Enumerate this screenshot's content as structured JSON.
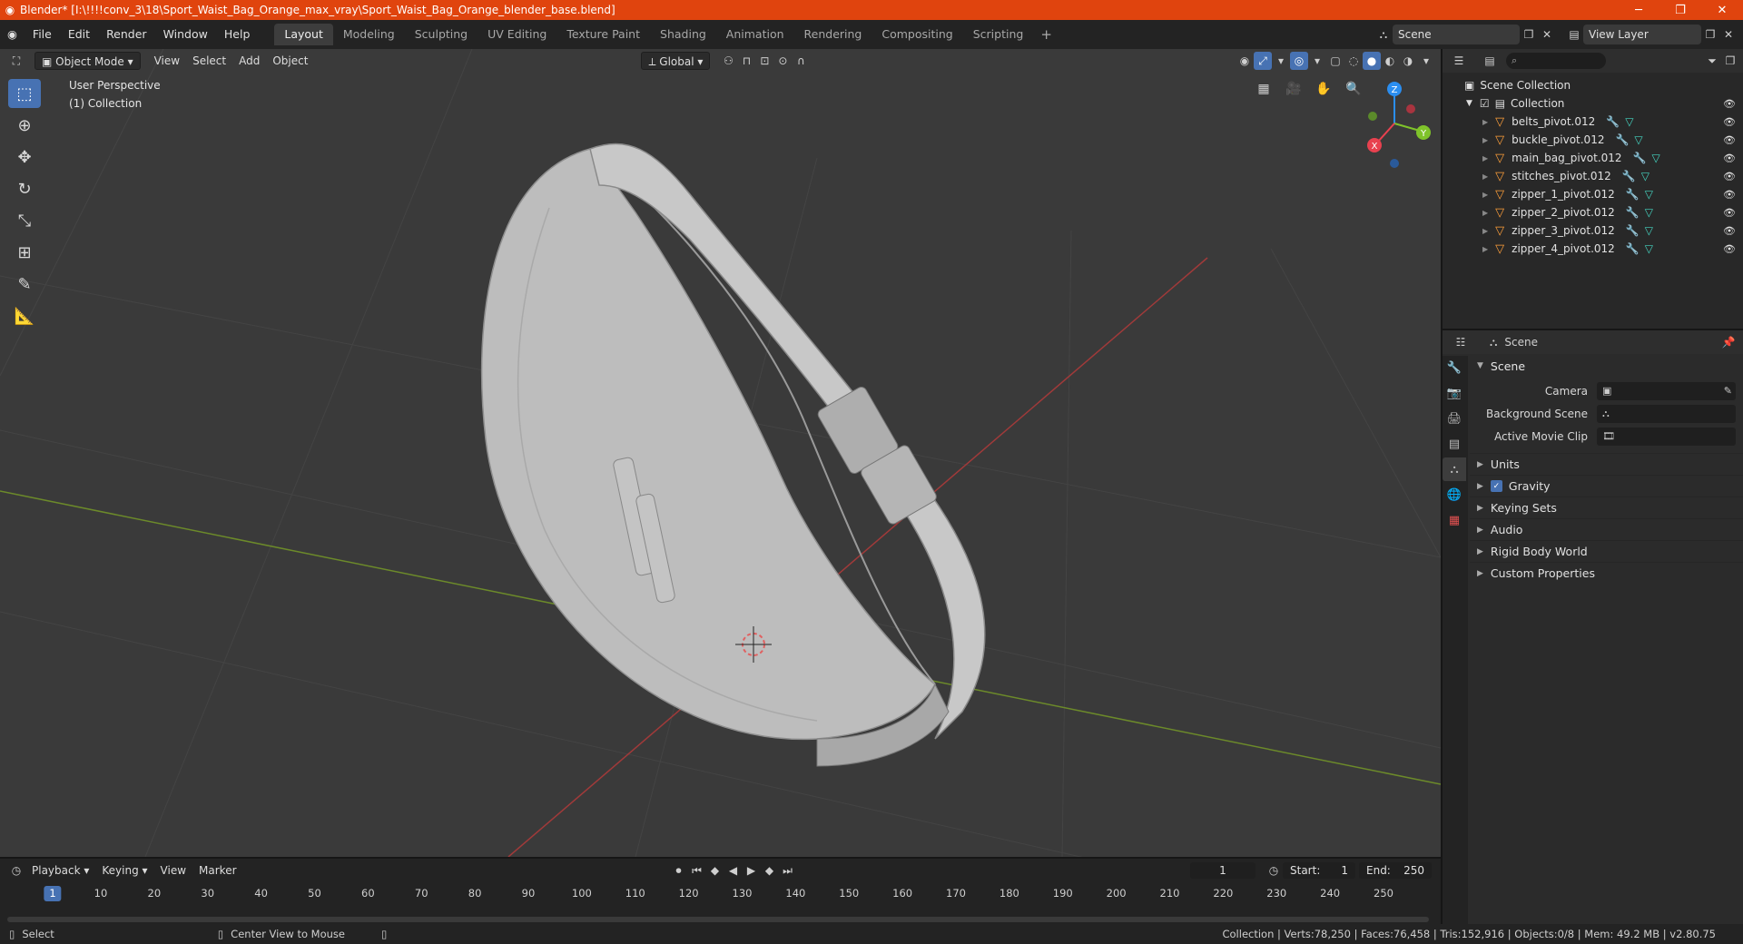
{
  "window": {
    "title": "Blender* [I:\\!!!!conv_3\\18\\Sport_Waist_Bag_Orange_max_vray\\Sport_Waist_Bag_Orange_blender_base.blend]",
    "controls": [
      "minimize",
      "maximize",
      "close"
    ]
  },
  "menu": [
    "File",
    "Edit",
    "Render",
    "Window",
    "Help"
  ],
  "workspaces": [
    "Layout",
    "Modeling",
    "Sculpting",
    "UV Editing",
    "Texture Paint",
    "Shading",
    "Animation",
    "Rendering",
    "Compositing",
    "Scripting"
  ],
  "active_workspace": "Layout",
  "scene_selector": "Scene",
  "view_layer_selector": "View Layer",
  "viewport": {
    "mode": "Object Mode",
    "menus": [
      "View",
      "Select",
      "Add",
      "Object"
    ],
    "orientation": "Global",
    "info_line1": "User Perspective",
    "info_line2": "(1) Collection",
    "gizmo_axes": {
      "x": "X",
      "y": "Y",
      "z": "Z"
    }
  },
  "outliner": {
    "root": "Scene Collection",
    "collection": "Collection",
    "items": [
      "belts_pivot.012",
      "buckle_pivot.012",
      "main_bag_pivot.012",
      "stitches_pivot.012",
      "zipper_1_pivot.012",
      "zipper_2_pivot.012",
      "zipper_3_pivot.012",
      "zipper_4_pivot.012"
    ]
  },
  "properties": {
    "context": "Scene",
    "panel_title": "Scene",
    "rows": [
      {
        "label": "Camera"
      },
      {
        "label": "Background Scene"
      },
      {
        "label": "Active Movie Clip"
      }
    ],
    "subpanels": [
      "Units",
      "Gravity",
      "Keying Sets",
      "Audio",
      "Rigid Body World",
      "Custom Properties"
    ],
    "gravity_enabled": true
  },
  "timeline": {
    "menus": [
      "Playback",
      "Keying",
      "View",
      "Marker"
    ],
    "current_frame": "1",
    "start_label": "Start:",
    "start": "1",
    "end_label": "End:",
    "end": "250",
    "ruler": [
      "1",
      "10",
      "20",
      "30",
      "40",
      "50",
      "60",
      "70",
      "80",
      "90",
      "100",
      "110",
      "120",
      "130",
      "140",
      "150",
      "160",
      "170",
      "180",
      "190",
      "200",
      "210",
      "220",
      "230",
      "240",
      "250"
    ]
  },
  "statusbar": {
    "left": "Select",
    "middle": "Center View to Mouse",
    "right": "Collection | Verts:78,250 | Faces:76,458 | Tris:152,916 | Objects:0/8 | Mem: 49.2 MB | v2.80.75"
  },
  "colors": {
    "accent": "#4772b3",
    "titlebar": "#e0440e",
    "object_icon": "#ff9f3a",
    "mesh_icon": "#44d4c0",
    "x_axis": "#e8414f",
    "y_axis": "#7fc32a",
    "z_axis": "#2b8ef0"
  }
}
